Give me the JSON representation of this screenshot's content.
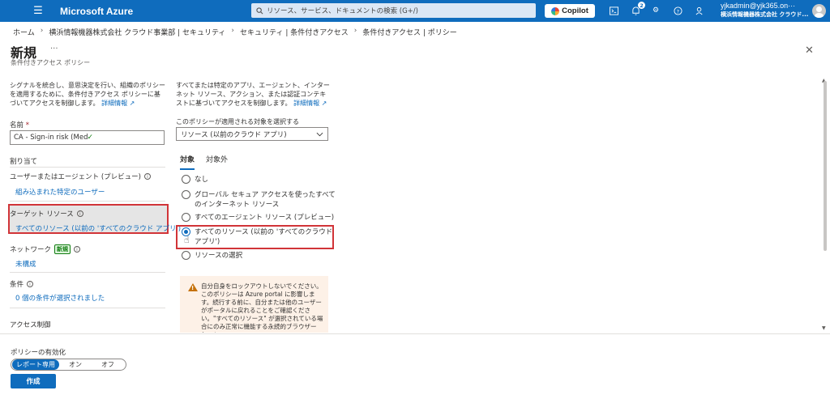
{
  "topbar": {
    "brand": "Microsoft Azure",
    "search_placeholder": "リソース、サービス、ドキュメントの検索 (G+/)",
    "copilot_label": "Copilot",
    "notification_count": "2",
    "account_name": "yjkadmin@yjk365.on···",
    "account_org": "横浜情報機器株式会社 クラウド..."
  },
  "breadcrumb": [
    "ホーム",
    "横浜情報機器株式会社 クラウド事業部 | セキュリティ",
    "セキュリティ | 条件付きアクセス",
    "条件付きアクセス | ポリシー"
  ],
  "header": {
    "title": "新規",
    "more": "···",
    "subtitle": "条件付きアクセス ポリシー",
    "close": "✕"
  },
  "left": {
    "intro": "シグナルを統合し、意思決定を行い、組織のポリシーを適用するために、条件付きアクセス ポリシーに基づいてアクセスを制御します。",
    "intro_link": "詳細情報",
    "name_label": "名前",
    "name_required": "*",
    "name_value": "CA - Sign-in risk (Medium+) require ···",
    "assign_heading": "割り当て",
    "users_label": "ユーザーまたはエージェント (プレビュー)",
    "users_value": "組み込まれた特定のユーザー",
    "target_label": "ターゲット リソース",
    "target_value": "すべてのリソース (以前の 'すべてのクラウド アプリ')",
    "network_label": "ネットワーク",
    "network_badge": "新規",
    "network_value": "未構成",
    "conditions_label": "条件",
    "conditions_value": "0 個の条件が選択されました",
    "access_heading": "アクセス制御"
  },
  "right": {
    "intro": "すべてまたは特定のアプリ、エージェント、インターネット リソース、アクション、または認証コンテキストに基づいてアクセスを制御します。",
    "intro_link": "詳細情報",
    "scope_label": "このポリシーが適用される対象を選択する",
    "scope_value": "リソース (以前のクラウド アプリ)",
    "tabs": [
      "対象",
      "対象外"
    ],
    "options": [
      "なし",
      "グローバル セキュア アクセスを使ったすべてのインターネット リソース",
      "すべてのエージェント リソース (プレビュー)",
      "すべてのリソース (以前の 'すべてのクラウド アプリ')",
      "リソースの選択"
    ],
    "warning": "自分自身をロックアウトしないでください。このポリシーは Azure portal に影響します。続行する前に、自分または他のユーザーがポータルに戻れることをご確認ください。\"すべてのリソース\" が選択されている場合にのみ正常に機能する永続的ブラウザー セッショ"
  },
  "footer": {
    "enable_label": "ポリシーの有効化",
    "toggle": [
      "レポート専用",
      "オン",
      "オフ"
    ],
    "create": "作成"
  },
  "colors": {
    "accent": "#0f6cbd",
    "highlight": "#d13438"
  }
}
